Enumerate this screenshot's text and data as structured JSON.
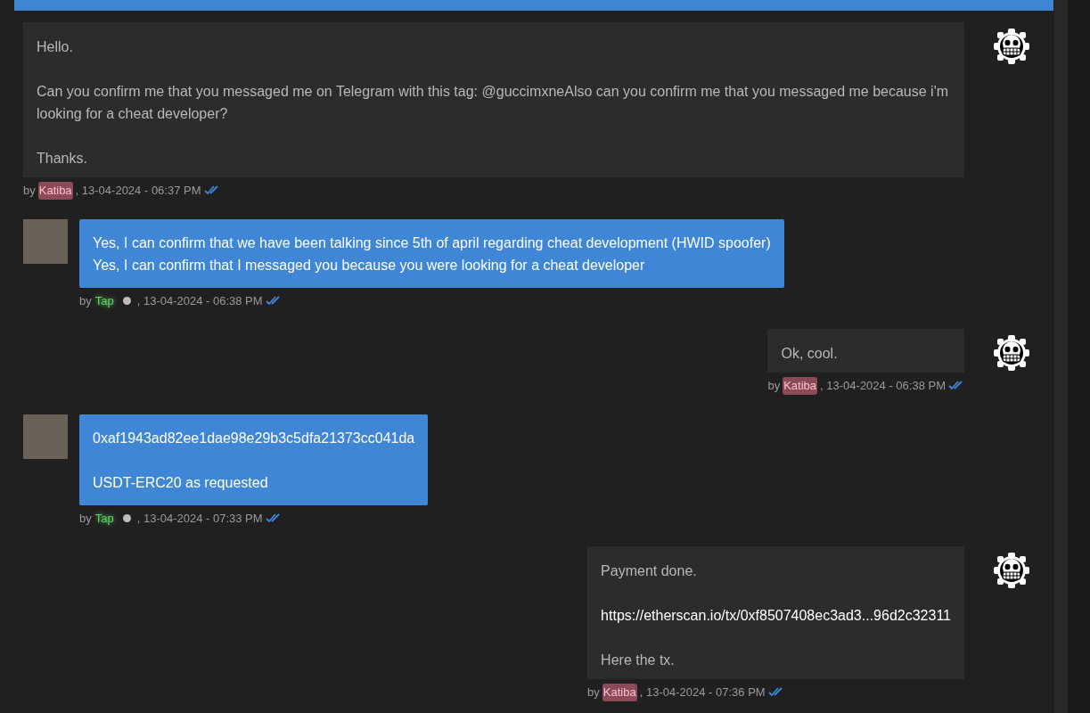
{
  "messages": [
    {
      "kind": "outgoing",
      "paragraphs": [
        {
          "kind": "text",
          "lines": [
            "Hello."
          ]
        },
        {
          "kind": "text",
          "lines": [
            "Can you confirm me that you messaged me on Telegram with this tag:  @guccimxneAlso can you confirm me that you messaged me because i'm looking for a cheat developer?"
          ]
        },
        {
          "kind": "text",
          "lines": [
            "Thanks."
          ]
        }
      ],
      "by": "by",
      "author": "Katiba",
      "color": "#8b4a58",
      "time": ", 13-04-2024 - 06:37 PM",
      "read": true
    },
    {
      "kind": "incoming",
      "paragraphs": [
        {
          "kind": "text",
          "lines": [
            "Yes, I can confirm that we have been talking since 5th of april regarding cheat development (HWID spoofer)",
            "Yes, I can confirm that I messaged you because you were looking for a cheat developer"
          ]
        }
      ],
      "by": "by",
      "author": "Tap",
      "color": "#5fd35f",
      "online": false,
      "time": ", 13-04-2024 - 06:38 PM",
      "read": true
    },
    {
      "kind": "outgoing",
      "paragraphs": [
        {
          "kind": "text",
          "lines": [
            "Ok, cool."
          ]
        }
      ],
      "by": "by",
      "author": "Katiba",
      "color": "#8b4a58",
      "time": ", 13-04-2024 - 06:38 PM",
      "read": true
    },
    {
      "kind": "incoming",
      "paragraphs": [
        {
          "kind": "text",
          "lines": [
            "0xaf1943ad82ee1dae98e29b3c5dfa21373cc041da"
          ]
        },
        {
          "kind": "text",
          "lines": [
            "USDT-ERC20 as requested"
          ]
        }
      ],
      "by": "by",
      "author": "Tap",
      "color": "#5fd35f",
      "online": false,
      "time": ", 13-04-2024 - 07:33 PM",
      "read": true
    },
    {
      "kind": "outgoing",
      "paragraphs": [
        {
          "kind": "text",
          "lines": [
            "Payment done."
          ]
        },
        {
          "kind": "link",
          "lines": [
            "https://etherscan.io/tx/0xf8507408ec3ad3...96d2c32311"
          ]
        },
        {
          "kind": "text",
          "lines": [
            "Here the tx."
          ]
        }
      ],
      "by": "by",
      "author": "Katiba",
      "color": "#8b4a58",
      "time": ", 13-04-2024 - 07:36 PM",
      "read": true
    }
  ]
}
